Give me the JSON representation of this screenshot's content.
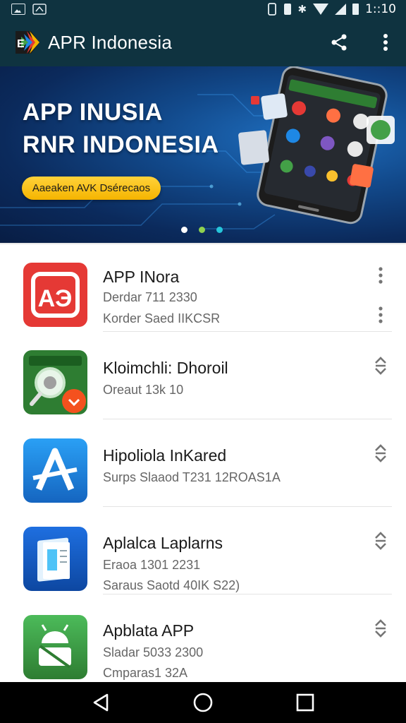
{
  "status_bar": {
    "time": "1::10",
    "icons": [
      "image-icon",
      "download-icon",
      "vibrate-icon",
      "sim-icon",
      "bluetooth-icon",
      "wifi-icon",
      "signal-icon",
      "battery-icon"
    ]
  },
  "app_bar": {
    "title": "APR Indonesia",
    "actions": [
      "share-icon",
      "more-vert-icon"
    ]
  },
  "banner": {
    "line1": "APP INUSIA",
    "line2": "RNR INDONESIA",
    "cta_label": "Aaeaken AVK Dsérecaos",
    "dots": 3,
    "dot_colors": [
      "#ffffff",
      "#8fd14f",
      "#26c6da"
    ]
  },
  "apps": [
    {
      "title": "APP INora",
      "sub1": "Derdar 711 2330",
      "sub2": "Korder Saed IIKCSR",
      "icon": "app-logo-icon",
      "action": "more-vert-icon",
      "icon_color": "#e53935"
    },
    {
      "title": "Kloimchli: Dhoroil",
      "sub1": "Oreaut 13k 10",
      "sub2": "",
      "icon": "search-icon",
      "action": "expand-icon",
      "icon_color": "#2e7d32"
    },
    {
      "title": "Hipoliola InKared",
      "sub1": "Surps Slaaod T231 12ROAS1A",
      "sub2": "",
      "icon": "a-letter-icon",
      "action": "expand-icon",
      "icon_color": "#1e88e5"
    },
    {
      "title": "Aplalca Laplarns",
      "sub1": "Eraoa 1301 2231",
      "sub2": "Saraus Saotd 40IK S22)",
      "icon": "document-icon",
      "action": "expand-icon",
      "icon_color": "#1e5fc9"
    },
    {
      "title": "Apblata APP",
      "sub1": "Sladar 5033 2300",
      "sub2": "Cmparas1 32A",
      "icon": "android-icon",
      "action": "expand-icon",
      "icon_color": "#43a047"
    }
  ],
  "nav_bar": {
    "buttons": [
      "back-icon",
      "home-icon",
      "recents-icon"
    ]
  }
}
